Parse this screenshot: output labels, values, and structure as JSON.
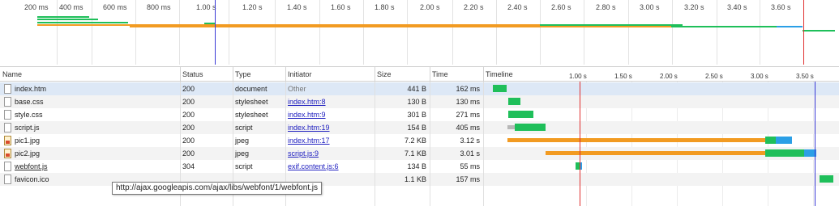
{
  "overview": {
    "ticks": [
      "200 ms",
      "400 ms",
      "600 ms",
      "800 ms",
      "1.00 s",
      "1.20 s",
      "1.40 s",
      "1.60 s",
      "1.80 s",
      "2.00 s",
      "2.20 s",
      "2.40 s",
      "2.60 s",
      "2.80 s",
      "3.00 s",
      "3.20 s",
      "3.40 s",
      "3.60 s"
    ]
  },
  "columns": {
    "name": "Name",
    "status": "Status",
    "type": "Type",
    "initiator": "Initiator",
    "size": "Size",
    "time": "Time",
    "timeline": "Timeline"
  },
  "timeline_ticks": [
    "1.00 s",
    "1.50 s",
    "2.00 s",
    "2.50 s",
    "3.00 s",
    "3.50 s"
  ],
  "rows": [
    {
      "name": "index.htm",
      "status": "200",
      "type": "document",
      "initiator": "Other",
      "size": "441 B",
      "time": "162 ms"
    },
    {
      "name": "base.css",
      "status": "200",
      "type": "stylesheet",
      "initiator": "index.htm:8",
      "size": "130 B",
      "time": "130 ms"
    },
    {
      "name": "style.css",
      "status": "200",
      "type": "stylesheet",
      "initiator": "index.htm:9",
      "size": "301 B",
      "time": "271 ms"
    },
    {
      "name": "script.js",
      "status": "200",
      "type": "script",
      "initiator": "index.htm:19",
      "size": "154 B",
      "time": "405 ms"
    },
    {
      "name": "pic1.jpg",
      "status": "200",
      "type": "jpeg",
      "initiator": "index.htm:17",
      "size": "7.2 KB",
      "time": "3.12 s"
    },
    {
      "name": "pic2.jpg",
      "status": "200",
      "type": "jpeg",
      "initiator": "script.js:9",
      "size": "7.1 KB",
      "time": "3.01 s"
    },
    {
      "name": "webfont.js",
      "status": "304",
      "type": "script",
      "initiator": "exif.content.js:6",
      "size": "134 B",
      "time": "55 ms"
    },
    {
      "name": "favicon.ico",
      "status": "",
      "type": "",
      "initiator": "",
      "size": "1.1 KB",
      "time": "157 ms"
    }
  ],
  "tooltip": "http://ajax.googleapis.com/ajax/libs/webfont/1/webfont.js",
  "colors": {
    "waiting": "#f29b22",
    "receiving": "#1fbf5a",
    "downloading": "#2b9fe6",
    "stalled": "#b8b8b8",
    "dom_content_loaded": "#3b3bd6",
    "load_event": "#e03030"
  }
}
